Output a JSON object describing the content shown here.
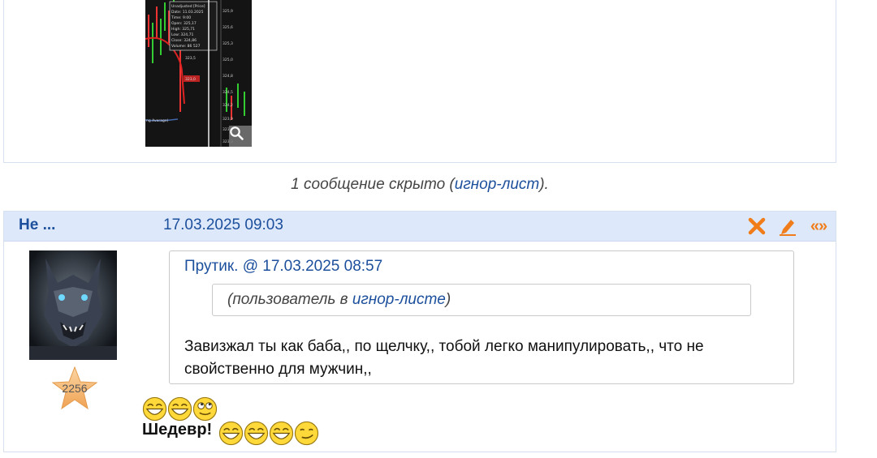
{
  "previous_post": {
    "image": {
      "chart_legend": [
        "Unadjusted [Price]",
        "Date: 11.03.2025",
        "Time: 9:00",
        "Open: 325,17",
        "High: 325,71",
        "Low: 324,71",
        "Close: 324,86",
        "Volume: 86 527"
      ],
      "price_ticks": [
        "325,9",
        "325,6",
        "325,3",
        "325,0",
        "324,8",
        "324,5",
        "324,2",
        "323,9",
        "323,6",
        "323,3"
      ],
      "marker_labels": [
        "323,5",
        "323,0"
      ],
      "bottom_label": "ng Average)",
      "zoom_icon": "magnifier-icon"
    }
  },
  "hidden_note": {
    "text": "1 сообщение скрыто (",
    "link": "игнор-лист",
    "suffix": ")."
  },
  "post": {
    "author": "Не ...",
    "date": "17.03.2025 09:03",
    "actions": {
      "delete_icon": "close-icon",
      "edit_icon": "pencil-icon",
      "quote_label": "«»"
    },
    "rating": "2256",
    "quote": {
      "header": "Прутик. @ 17.03.2025 08:57",
      "inner_prefix": "(пользователь в ",
      "inner_link": "игнор-листе",
      "inner_suffix": ")",
      "text": "Завизжал ты как баба,, по щелчку,, тобой легко манипулировать,, что не свойственно для мужчин,,"
    },
    "smileys_row1": [
      "laughing",
      "laughing",
      "rolling-eyes"
    ],
    "body_text": "Шедевр!",
    "smileys_row2": [
      "laughing",
      "laughing",
      "laughing",
      "smirk"
    ]
  },
  "colors": {
    "link": "#1c4f9c",
    "header_bg": "#dde8fb",
    "action_orange": "#f07d1a"
  }
}
